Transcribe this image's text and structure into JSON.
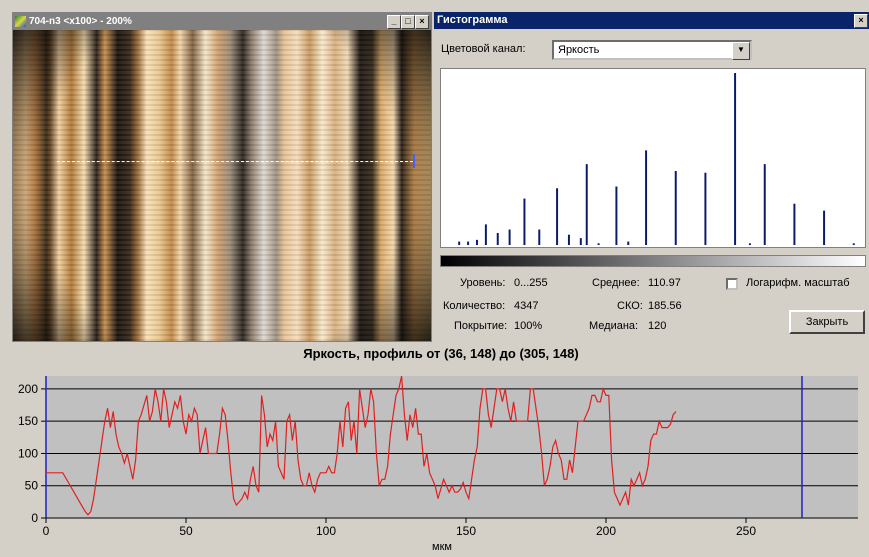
{
  "image_window": {
    "title": "704-n3 <x100> - 200%",
    "btn_min": "_",
    "btn_max": "□",
    "btn_close": "×"
  },
  "histogram_window": {
    "title": "Гистограмма",
    "close": "×",
    "channel_label": "Цветовой канал:",
    "channel_value": "Яркость",
    "stats": {
      "level_label": "Уровень:",
      "level_value": "0...255",
      "count_label": "Количество:",
      "count_value": "4347",
      "coverage_label": "Покрытие:",
      "coverage_value": "100%",
      "mean_label": "Среднее:",
      "mean_value": "110.97",
      "sko_label": "СКО:",
      "sko_value": "185.56",
      "median_label": "Медиана:",
      "median_value": "120"
    },
    "log_scale_label": "Логарифм. масштаб",
    "log_scale_checked": false,
    "close_button": "Закрыть",
    "bar_color": "#0a1a6a",
    "bars": [
      {
        "x": 3,
        "h": 0.02
      },
      {
        "x": 6,
        "h": 0.02
      },
      {
        "x": 9,
        "h": 0.03
      },
      {
        "x": 12,
        "h": 0.12
      },
      {
        "x": 16,
        "h": 0.07
      },
      {
        "x": 20,
        "h": 0.09
      },
      {
        "x": 25,
        "h": 0.27
      },
      {
        "x": 30,
        "h": 0.09
      },
      {
        "x": 36,
        "h": 0.33
      },
      {
        "x": 40,
        "h": 0.06
      },
      {
        "x": 44,
        "h": 0.04
      },
      {
        "x": 46,
        "h": 0.47
      },
      {
        "x": 50,
        "h": 0.01
      },
      {
        "x": 56,
        "h": 0.34
      },
      {
        "x": 60,
        "h": 0.02
      },
      {
        "x": 66,
        "h": 0.55
      },
      {
        "x": 76,
        "h": 0.43
      },
      {
        "x": 86,
        "h": 0.42
      },
      {
        "x": 96,
        "h": 1.0
      },
      {
        "x": 101,
        "h": 0.01
      },
      {
        "x": 106,
        "h": 0.47
      },
      {
        "x": 116,
        "h": 0.24
      },
      {
        "x": 126,
        "h": 0.2
      },
      {
        "x": 136,
        "h": 0.01
      }
    ]
  },
  "profile": {
    "title": "Яркость, профиль от (36, 148) до (305, 148)",
    "line_color": "#e02020",
    "marker_color": "#2020c0",
    "chart_data": {
      "type": "line",
      "xlabel": "мкм",
      "ylabel": "",
      "xlim": [
        0,
        290
      ],
      "ylim": [
        0,
        220
      ],
      "x_ticks": [
        0,
        50,
        100,
        150,
        200,
        250
      ],
      "y_ticks": [
        0,
        50,
        100,
        150,
        200
      ],
      "grid": true,
      "marker_x": 270,
      "x": [
        0,
        2,
        4,
        6,
        8,
        10,
        12,
        14,
        15,
        16,
        17,
        18,
        19,
        20,
        21,
        22,
        23,
        24,
        25,
        26,
        27,
        28,
        29,
        30,
        31,
        32,
        33,
        34,
        35,
        36,
        37,
        38,
        39,
        40,
        41,
        42,
        43,
        44,
        45,
        46,
        47,
        48,
        49,
        50,
        51,
        52,
        53,
        54,
        55,
        56,
        57,
        58,
        59,
        60,
        61,
        62,
        63,
        64,
        65,
        66,
        67,
        68,
        69,
        70,
        71,
        72,
        73,
        74,
        75,
        76,
        77,
        78,
        79,
        80,
        81,
        82,
        83,
        84,
        85,
        86,
        87,
        88,
        89,
        90,
        91,
        92,
        93,
        94,
        95,
        96,
        97,
        98,
        99,
        100,
        101,
        102,
        103,
        104,
        105,
        106,
        107,
        108,
        109,
        110,
        111,
        112,
        113,
        114,
        115,
        116,
        117,
        118,
        119,
        120,
        121,
        122,
        123,
        124,
        125,
        126,
        127,
        128,
        129,
        130,
        131,
        132,
        133,
        134,
        135,
        136,
        137,
        138,
        139,
        140,
        141,
        142,
        143,
        144,
        145,
        146,
        147,
        148,
        149,
        150,
        151,
        152,
        153,
        154,
        155,
        156,
        157,
        158,
        159,
        160,
        161,
        162,
        163,
        164,
        165,
        166,
        167,
        168,
        169,
        170,
        171,
        172,
        173,
        174,
        175,
        176,
        177,
        178,
        179,
        180,
        181,
        182,
        183,
        184,
        185,
        186,
        187,
        188,
        189,
        190,
        191,
        192,
        193,
        194,
        195,
        196,
        197,
        198,
        199,
        200,
        201,
        202,
        203,
        204,
        205,
        206,
        207,
        208,
        209,
        210,
        211,
        212,
        213,
        214,
        215,
        216,
        217,
        218,
        219,
        220,
        221,
        222,
        223,
        224,
        225,
        226,
        227,
        228,
        229,
        230,
        231,
        232,
        233,
        234,
        235,
        236,
        237,
        238,
        239,
        240,
        241,
        242,
        243,
        244,
        245,
        246,
        247,
        248,
        249,
        250,
        251,
        252,
        253,
        254,
        255,
        256,
        257,
        258,
        259,
        260,
        261,
        262,
        263,
        264,
        265,
        266,
        267,
        268,
        269,
        270
      ],
      "y": [
        70,
        70,
        70,
        70,
        55,
        40,
        25,
        10,
        5,
        10,
        30,
        60,
        90,
        120,
        150,
        170,
        140,
        165,
        130,
        110,
        100,
        85,
        100,
        80,
        60,
        90,
        150,
        160,
        175,
        190,
        150,
        165,
        200,
        180,
        150,
        200,
        180,
        140,
        160,
        180,
        170,
        190,
        150,
        130,
        160,
        150,
        170,
        160,
        100,
        120,
        140,
        100,
        100,
        100,
        100,
        130,
        170,
        160,
        120,
        70,
        30,
        20,
        25,
        30,
        40,
        30,
        60,
        80,
        50,
        40,
        190,
        160,
        110,
        130,
        120,
        150,
        80,
        70,
        60,
        150,
        160,
        120,
        150,
        90,
        60,
        50,
        50,
        70,
        50,
        40,
        60,
        70,
        70,
        70,
        80,
        70,
        70,
        100,
        150,
        110,
        170,
        180,
        120,
        150,
        100,
        200,
        170,
        140,
        160,
        200,
        180,
        100,
        50,
        60,
        60,
        80,
        130,
        160,
        190,
        200,
        220,
        160,
        120,
        160,
        140,
        170,
        130,
        130,
        80,
        100,
        70,
        60,
        50,
        30,
        45,
        60,
        50,
        40,
        50,
        40,
        40,
        45,
        55,
        40,
        30,
        60,
        90,
        110,
        170,
        200,
        200,
        160,
        140,
        170,
        200,
        200,
        180,
        200,
        170,
        150,
        180,
        150,
        150,
        150,
        150,
        150,
        200,
        200,
        170,
        140,
        100,
        50,
        60,
        80,
        110,
        120,
        100,
        90,
        60,
        60,
        90,
        70,
        110,
        150,
        150,
        150,
        160,
        170,
        190,
        190,
        180,
        180,
        200,
        190,
        190,
        90,
        40,
        30,
        20,
        30,
        40,
        20,
        60,
        50,
        60,
        70,
        50,
        60,
        80,
        120,
        130,
        130,
        150,
        140,
        140,
        140,
        145,
        160,
        165
      ]
    }
  }
}
